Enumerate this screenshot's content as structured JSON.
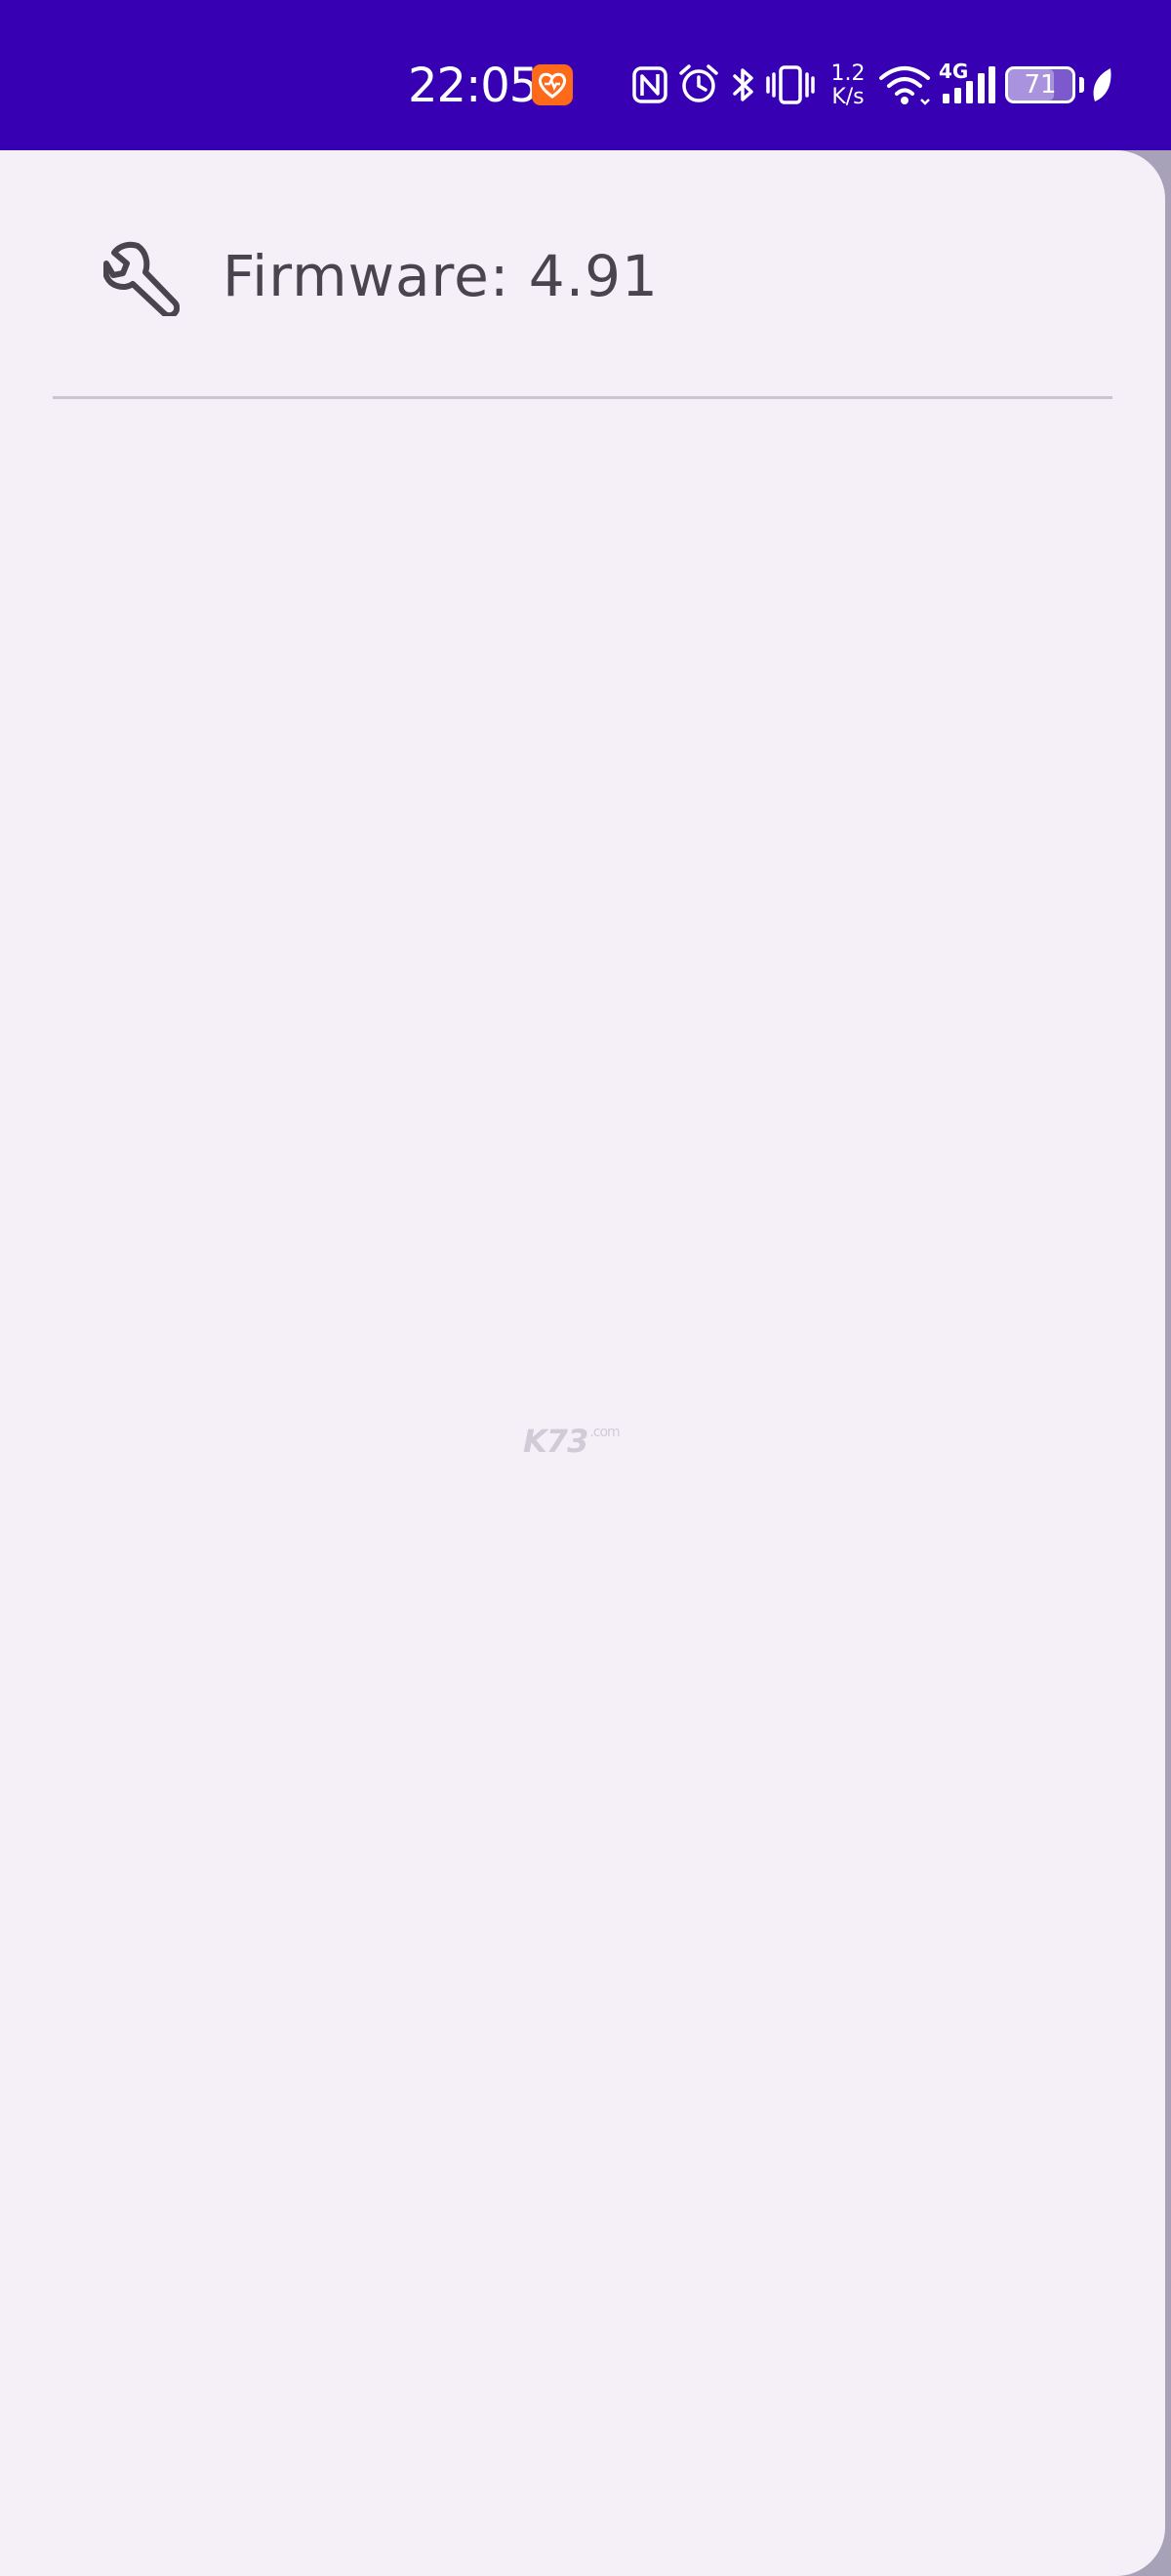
{
  "status_bar": {
    "time": "22:05",
    "network_speed_value": "1.2",
    "network_speed_unit": "K/s",
    "network_type": "4G",
    "battery_level": "71",
    "icons": [
      "health-app-icon",
      "nfc-icon",
      "alarm-icon",
      "bluetooth-icon",
      "vibrate-icon",
      "wifi-icon",
      "cellular-signal-icon",
      "battery-icon",
      "leaf-icon"
    ],
    "background_color": "#3700b3",
    "app_badge_color": "#ff6a1a"
  },
  "drawer": {
    "firmware_label": "Firmware: 4.91",
    "firmware_icon": "wrench-icon",
    "background_color": "#f5f0f8",
    "text_color": "#49454f",
    "divider_color": "#cac4d0"
  },
  "watermark": {
    "brand": "K73",
    "sub": ".com"
  }
}
